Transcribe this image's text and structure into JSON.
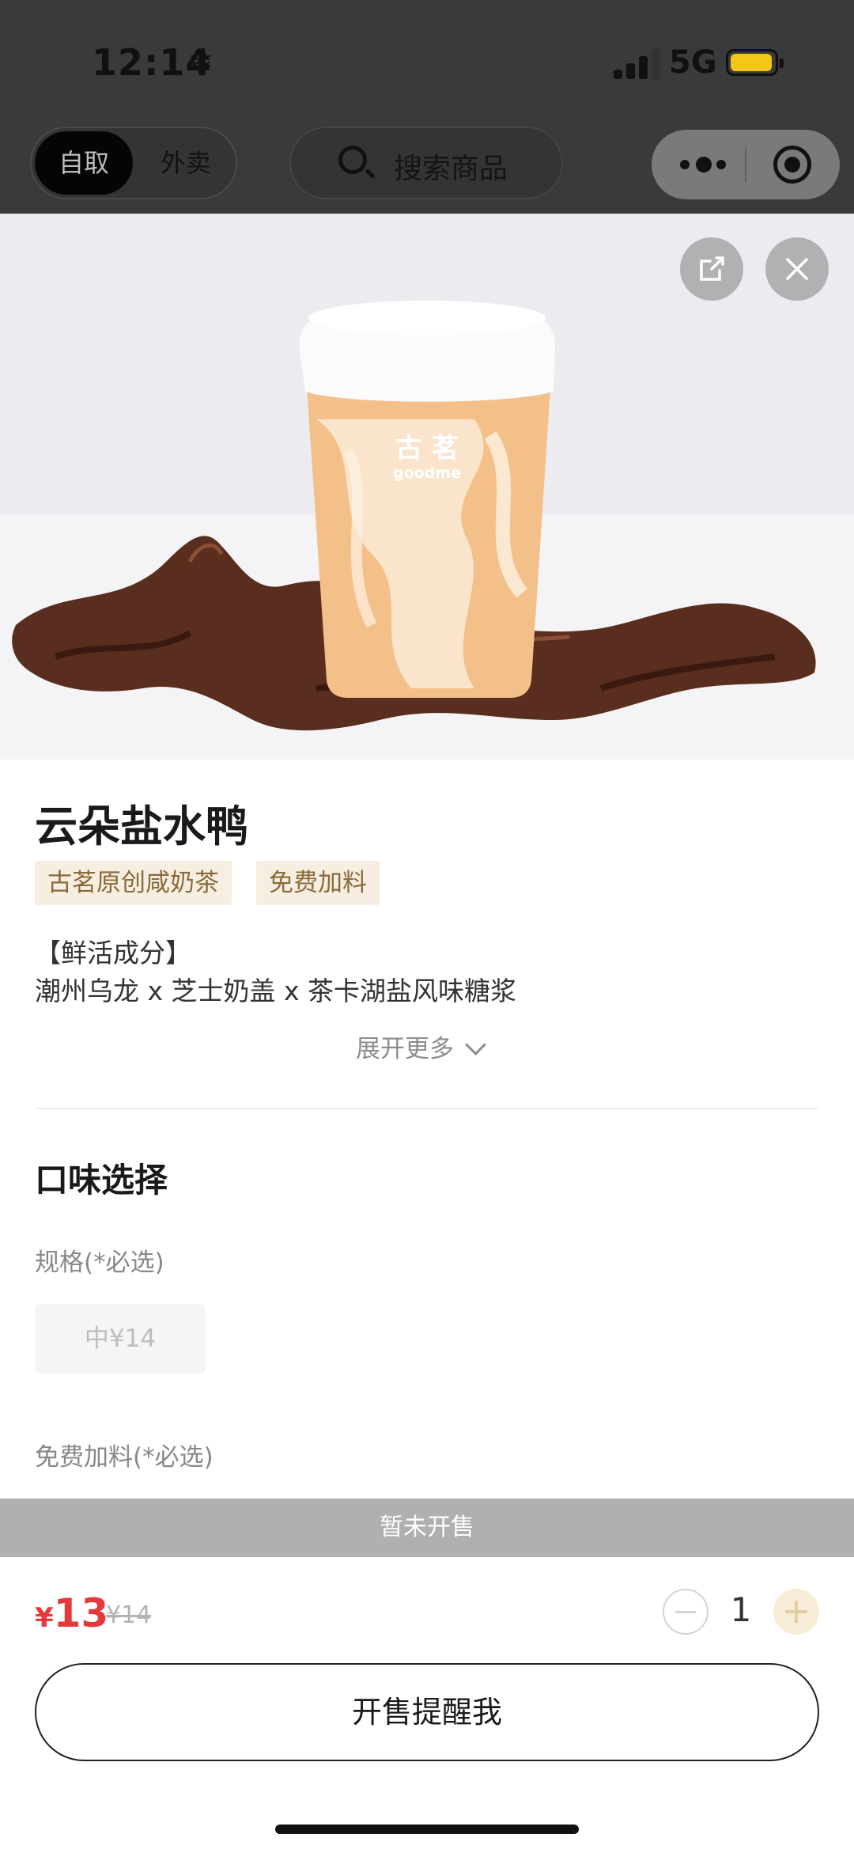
{
  "status_bar": {
    "time": "12:14",
    "network": "5G"
  },
  "nav": {
    "mode_selected": "自取",
    "mode_other": "外卖",
    "search_placeholder": "搜索商品"
  },
  "product": {
    "name": "云朵盐水鸭",
    "tags": [
      "古茗原创咸奶茶",
      "免费加料"
    ],
    "desc_heading": "【鲜活成分】",
    "desc_body": "潮州乌龙 x 芝士奶盖 x 茶卡湖盐风味糖浆",
    "expand_label": "展开更多",
    "cup_brand_cn": "古 茗",
    "cup_brand_en": "goodme"
  },
  "options": {
    "section_title": "口味选择",
    "size_label": "规格(*必选)",
    "size_choice": "中¥14",
    "topping_label": "免费加料(*必选)"
  },
  "footer": {
    "notice": "暂未开售",
    "currency": "¥",
    "price": "13",
    "original_price": "¥14",
    "quantity": "1",
    "remind_label": "开售提醒我"
  },
  "colors": {
    "accent_price": "#e5393b",
    "tag_bg": "#f6efe1",
    "tag_text": "#8a6a3a",
    "battery": "#f3c61a"
  }
}
